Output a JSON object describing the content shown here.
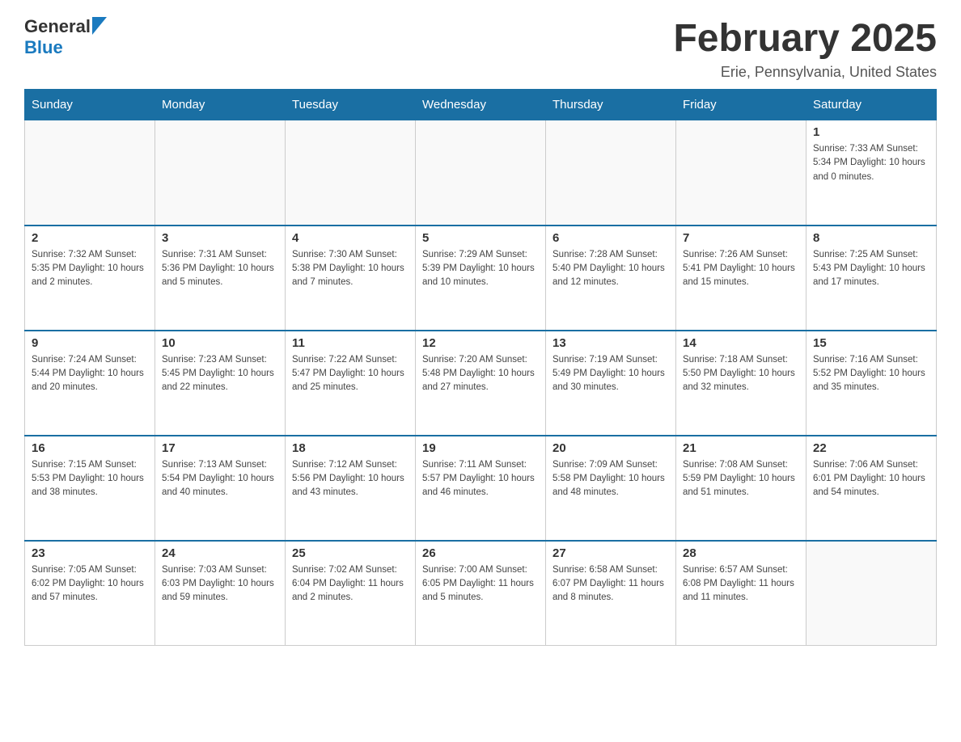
{
  "logo": {
    "text_general": "General",
    "text_blue": "Blue",
    "arrow_shape": "triangle"
  },
  "header": {
    "title": "February 2025",
    "subtitle": "Erie, Pennsylvania, United States"
  },
  "days_of_week": [
    "Sunday",
    "Monday",
    "Tuesday",
    "Wednesday",
    "Thursday",
    "Friday",
    "Saturday"
  ],
  "weeks": [
    {
      "cells": [
        {
          "day": "",
          "info": ""
        },
        {
          "day": "",
          "info": ""
        },
        {
          "day": "",
          "info": ""
        },
        {
          "day": "",
          "info": ""
        },
        {
          "day": "",
          "info": ""
        },
        {
          "day": "",
          "info": ""
        },
        {
          "day": "1",
          "info": "Sunrise: 7:33 AM\nSunset: 5:34 PM\nDaylight: 10 hours\nand 0 minutes."
        }
      ]
    },
    {
      "cells": [
        {
          "day": "2",
          "info": "Sunrise: 7:32 AM\nSunset: 5:35 PM\nDaylight: 10 hours\nand 2 minutes."
        },
        {
          "day": "3",
          "info": "Sunrise: 7:31 AM\nSunset: 5:36 PM\nDaylight: 10 hours\nand 5 minutes."
        },
        {
          "day": "4",
          "info": "Sunrise: 7:30 AM\nSunset: 5:38 PM\nDaylight: 10 hours\nand 7 minutes."
        },
        {
          "day": "5",
          "info": "Sunrise: 7:29 AM\nSunset: 5:39 PM\nDaylight: 10 hours\nand 10 minutes."
        },
        {
          "day": "6",
          "info": "Sunrise: 7:28 AM\nSunset: 5:40 PM\nDaylight: 10 hours\nand 12 minutes."
        },
        {
          "day": "7",
          "info": "Sunrise: 7:26 AM\nSunset: 5:41 PM\nDaylight: 10 hours\nand 15 minutes."
        },
        {
          "day": "8",
          "info": "Sunrise: 7:25 AM\nSunset: 5:43 PM\nDaylight: 10 hours\nand 17 minutes."
        }
      ]
    },
    {
      "cells": [
        {
          "day": "9",
          "info": "Sunrise: 7:24 AM\nSunset: 5:44 PM\nDaylight: 10 hours\nand 20 minutes."
        },
        {
          "day": "10",
          "info": "Sunrise: 7:23 AM\nSunset: 5:45 PM\nDaylight: 10 hours\nand 22 minutes."
        },
        {
          "day": "11",
          "info": "Sunrise: 7:22 AM\nSunset: 5:47 PM\nDaylight: 10 hours\nand 25 minutes."
        },
        {
          "day": "12",
          "info": "Sunrise: 7:20 AM\nSunset: 5:48 PM\nDaylight: 10 hours\nand 27 minutes."
        },
        {
          "day": "13",
          "info": "Sunrise: 7:19 AM\nSunset: 5:49 PM\nDaylight: 10 hours\nand 30 minutes."
        },
        {
          "day": "14",
          "info": "Sunrise: 7:18 AM\nSunset: 5:50 PM\nDaylight: 10 hours\nand 32 minutes."
        },
        {
          "day": "15",
          "info": "Sunrise: 7:16 AM\nSunset: 5:52 PM\nDaylight: 10 hours\nand 35 minutes."
        }
      ]
    },
    {
      "cells": [
        {
          "day": "16",
          "info": "Sunrise: 7:15 AM\nSunset: 5:53 PM\nDaylight: 10 hours\nand 38 minutes."
        },
        {
          "day": "17",
          "info": "Sunrise: 7:13 AM\nSunset: 5:54 PM\nDaylight: 10 hours\nand 40 minutes."
        },
        {
          "day": "18",
          "info": "Sunrise: 7:12 AM\nSunset: 5:56 PM\nDaylight: 10 hours\nand 43 minutes."
        },
        {
          "day": "19",
          "info": "Sunrise: 7:11 AM\nSunset: 5:57 PM\nDaylight: 10 hours\nand 46 minutes."
        },
        {
          "day": "20",
          "info": "Sunrise: 7:09 AM\nSunset: 5:58 PM\nDaylight: 10 hours\nand 48 minutes."
        },
        {
          "day": "21",
          "info": "Sunrise: 7:08 AM\nSunset: 5:59 PM\nDaylight: 10 hours\nand 51 minutes."
        },
        {
          "day": "22",
          "info": "Sunrise: 7:06 AM\nSunset: 6:01 PM\nDaylight: 10 hours\nand 54 minutes."
        }
      ]
    },
    {
      "cells": [
        {
          "day": "23",
          "info": "Sunrise: 7:05 AM\nSunset: 6:02 PM\nDaylight: 10 hours\nand 57 minutes."
        },
        {
          "day": "24",
          "info": "Sunrise: 7:03 AM\nSunset: 6:03 PM\nDaylight: 10 hours\nand 59 minutes."
        },
        {
          "day": "25",
          "info": "Sunrise: 7:02 AM\nSunset: 6:04 PM\nDaylight: 11 hours\nand 2 minutes."
        },
        {
          "day": "26",
          "info": "Sunrise: 7:00 AM\nSunset: 6:05 PM\nDaylight: 11 hours\nand 5 minutes."
        },
        {
          "day": "27",
          "info": "Sunrise: 6:58 AM\nSunset: 6:07 PM\nDaylight: 11 hours\nand 8 minutes."
        },
        {
          "day": "28",
          "info": "Sunrise: 6:57 AM\nSunset: 6:08 PM\nDaylight: 11 hours\nand 11 minutes."
        },
        {
          "day": "",
          "info": ""
        }
      ]
    }
  ]
}
